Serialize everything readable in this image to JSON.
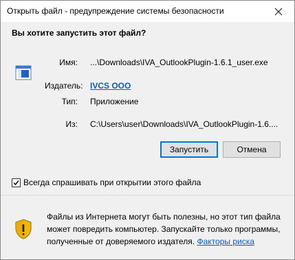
{
  "window": {
    "title": "Открыть файл - предупреждение системы безопасности"
  },
  "dialog": {
    "question": "Вы хотите запустить этот файл?",
    "fields": {
      "name_label": "Имя:",
      "name_value": "...\\Downloads\\IVA_OutlookPlugin-1.6.1_user.exe",
      "publisher_label": "Издатель:",
      "publisher_value": "IVCS OOO",
      "type_label": "Тип:",
      "type_value": "Приложение",
      "from_label": "Из:",
      "from_value": "C:\\Users\\user\\Downloads\\IVA_OutlookPlugin-1.6...."
    },
    "buttons": {
      "run": "Запустить",
      "cancel": "Отмена"
    },
    "checkbox": {
      "label": "Всегда спрашивать при открытии этого файла",
      "checked": true
    }
  },
  "warning": {
    "text": "Файлы из Интернета могут быть полезны, но этот тип файла может повредить компьютер. Запускайте только программы, полученные от доверяемого издателя.",
    "link": "Факторы риска"
  },
  "colors": {
    "link": "#0b5cc9",
    "default_button_border": "#0078d7",
    "background": "#f0f0f0"
  }
}
